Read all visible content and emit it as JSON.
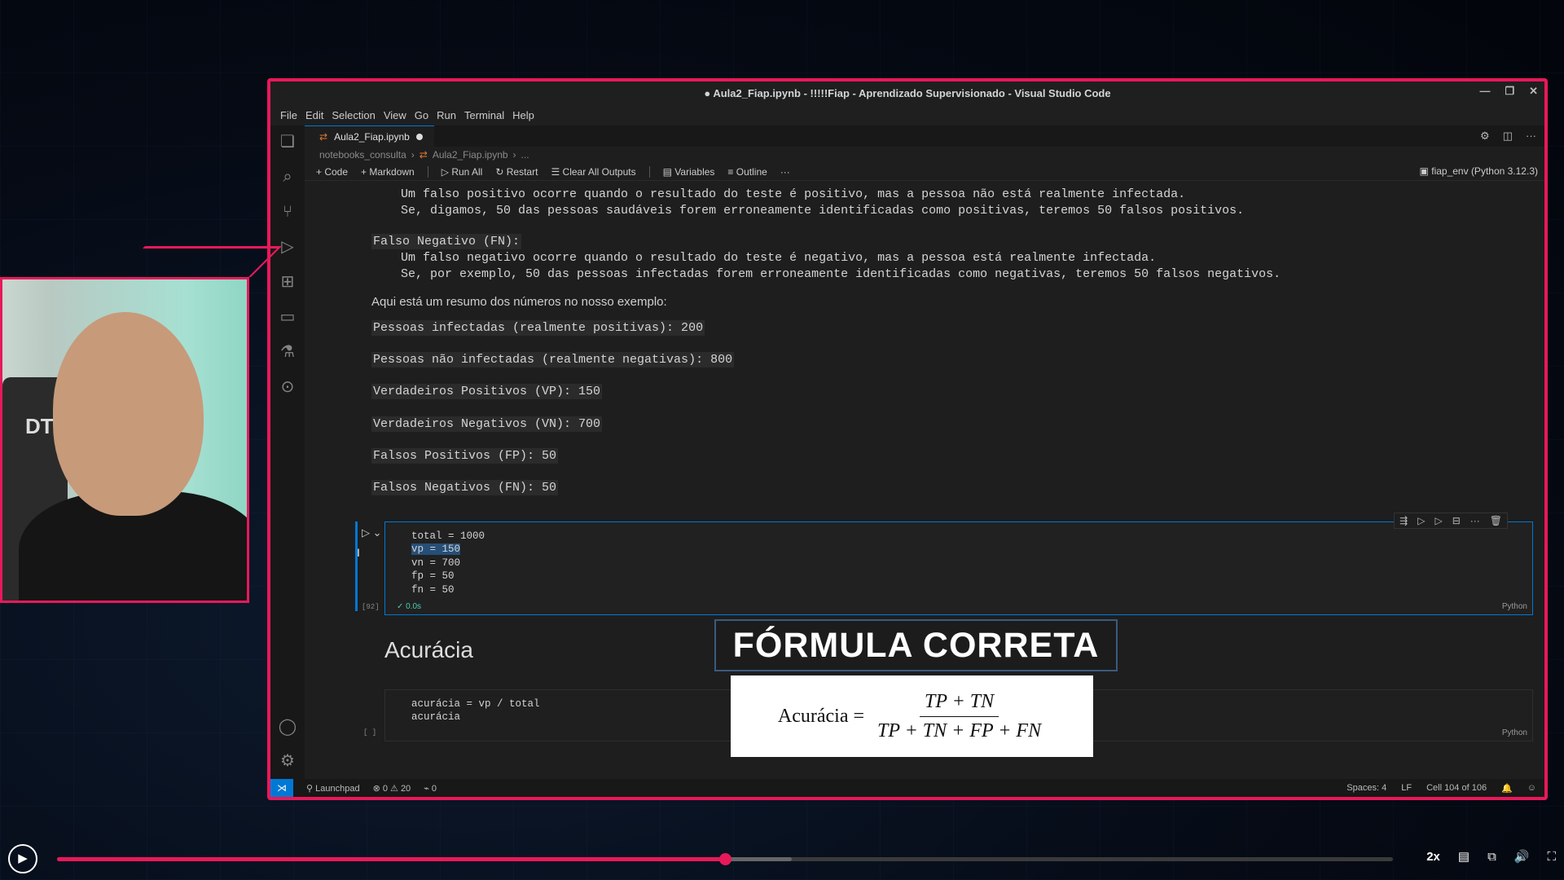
{
  "window": {
    "title": "● Aula2_Fiap.ipynb - !!!!!Fiap - Aprendizado Supervisionado - Visual Studio Code"
  },
  "menu": [
    "File",
    "Edit",
    "Selection",
    "View",
    "Go",
    "Run",
    "Terminal",
    "Help"
  ],
  "tab": {
    "label": "Aula2_Fiap.ipynb"
  },
  "breadcrumb": {
    "folder": "notebooks_consulta",
    "file": "Aula2_Fiap.ipynb",
    "more": "..."
  },
  "toolbar": {
    "code": "Code",
    "markdown": "Markdown",
    "run_all": "Run All",
    "restart": "Restart",
    "clear_outputs": "Clear All Outputs",
    "variables": "Variables",
    "outline": "Outline",
    "more": "···",
    "kernel": "fiap_env (Python 3.12.3)"
  },
  "markdown": {
    "fp_line1": "    Um falso positivo ocorre quando o resultado do teste é positivo, mas a pessoa não está realmente infectada.",
    "fp_line2": "    Se, digamos, 50 das pessoas saudáveis forem erroneamente identificadas como positivas, teremos 50 falsos positivos.",
    "fn_title": "Falso Negativo (FN):",
    "fn_line1": "    Um falso negativo ocorre quando o resultado do teste é negativo, mas a pessoa está realmente infectada.",
    "fn_line2": "    Se, por exemplo, 50 das pessoas infectadas forem erroneamente identificadas como negativas, teremos 50 falsos negativos.",
    "summary": "Aqui está um resumo dos números no nosso exemplo:",
    "items": [
      "Pessoas infectadas (realmente positivas): 200",
      "Pessoas não infectadas (realmente negativas): 800",
      "Verdadeiros Positivos (VP): 150",
      "Verdadeiros Negativos (VN): 700",
      "Falsos Positivos (FP): 50",
      "Falsos Negativos (FN): 50"
    ]
  },
  "cell1": {
    "lines": [
      "total = 1000",
      "vp = 150",
      "vn = 700",
      "fp = 50",
      "fn = 50"
    ],
    "exec_count": "[92]",
    "status": "✓  0.0s",
    "lang": "Python"
  },
  "heading": "Acurácia",
  "cell2": {
    "lines": [
      "acurácia = vp / total",
      "acurácia"
    ],
    "exec_count": "[ ]",
    "lang": "Python"
  },
  "overlay": {
    "title": "FÓRMULA CORRETA",
    "lhs": "Acurácia =",
    "numerator": "TP + TN",
    "denominator": "TP + TN + FP + FN"
  },
  "statusbar": {
    "launchpad": "Launchpad",
    "problems": "⊗ 0 ⚠ 20",
    "ports": "⌁ 0",
    "spaces": "Spaces: 4",
    "eol": "LF",
    "cell_pos": "Cell 104 of 106"
  },
  "player": {
    "progress": 0.5,
    "buffered": 0.55,
    "speed": "2x"
  },
  "colors": {
    "accent": "#e8195a",
    "vscode_blue": "#0078d4"
  }
}
